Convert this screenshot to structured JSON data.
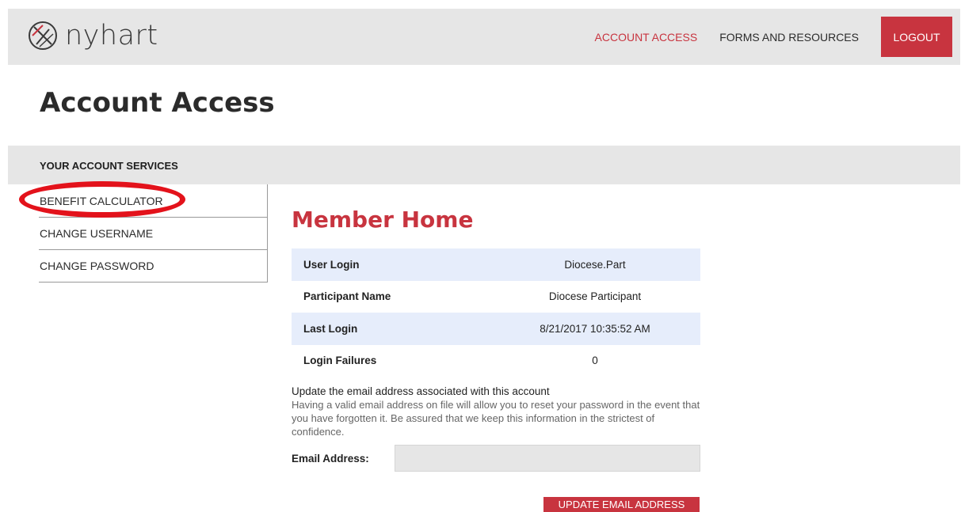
{
  "brand": {
    "logo_text": "nyhart"
  },
  "nav": {
    "account_access": "ACCOUNT ACCESS",
    "forms_resources": "FORMS AND RESOURCES",
    "logout": "LOGOUT"
  },
  "page": {
    "title": "Account Access"
  },
  "services": {
    "heading": "YOUR ACCOUNT SERVICES",
    "items": [
      {
        "label": "BENEFIT CALCULATOR"
      },
      {
        "label": "CHANGE USERNAME"
      },
      {
        "label": "CHANGE PASSWORD"
      }
    ]
  },
  "member": {
    "title": "Member Home",
    "rows": [
      {
        "label": "User Login",
        "value": "Diocese.Part"
      },
      {
        "label": "Participant Name",
        "value": "Diocese Participant"
      },
      {
        "label": "Last Login",
        "value": "8/21/2017 10:35:52 AM"
      },
      {
        "label": "Login Failures",
        "value": "0"
      }
    ]
  },
  "email": {
    "heading": "Update the email address associated with this account",
    "description": "Having a valid email address on file will allow you to reset your password in the event that you have forgotten it. Be assured that we keep this information in the strictest of confidence.",
    "label": "Email Address:",
    "value": "",
    "button": "UPDATE EMAIL ADDRESS"
  },
  "colors": {
    "accent": "#c8343f",
    "annotation_ring": "#e3121b",
    "header_bg": "#e6e6e6",
    "row_shade": "#e6edfb"
  }
}
